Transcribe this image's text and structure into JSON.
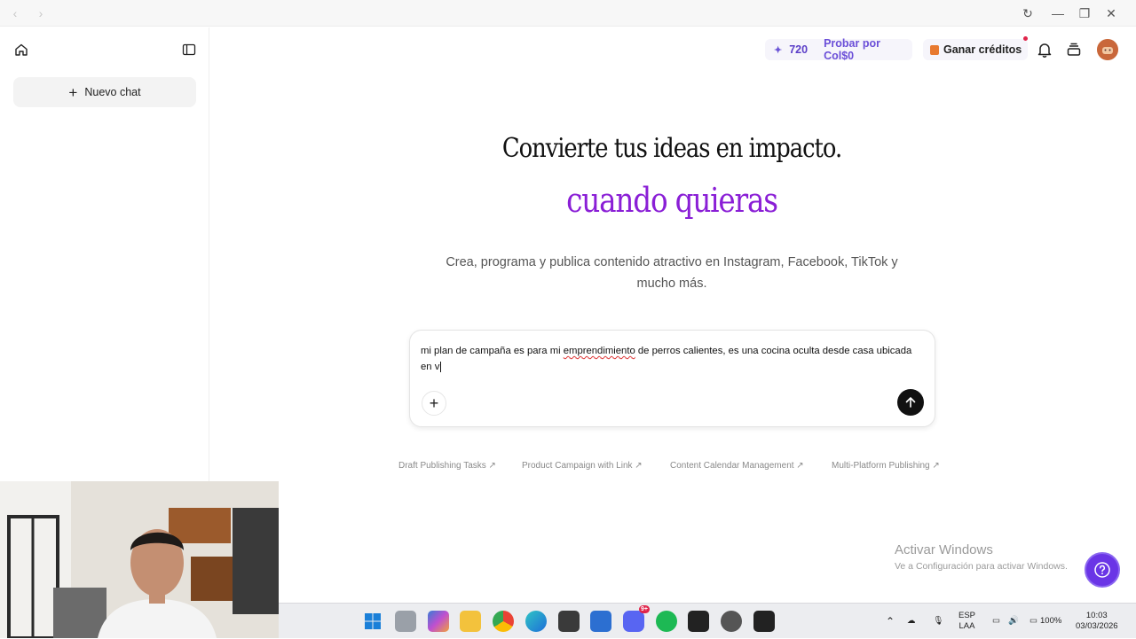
{
  "window": {
    "back_icon": "‹",
    "forward_icon": "›",
    "reload_icon": "↻",
    "minimize_icon": "—",
    "restore_icon": "❐",
    "close_icon": "✕"
  },
  "sidebar": {
    "new_chat_label": "Nuevo chat"
  },
  "header": {
    "credits_count": "720",
    "try_label": "Probar por Col$0",
    "earn_label": "Ganar créditos"
  },
  "hero": {
    "title": "Convierte tus ideas en impacto.",
    "highlight": "cuando quieras",
    "subtitle": "Crea, programa y publica contenido atractivo en Instagram, Facebook, TikTok y mucho más."
  },
  "composer": {
    "text_before": "mi plan de campaña es para mi ",
    "text_misspelled": "emprendimiento",
    "text_after": " de perros calientes, es una cocina oculta desde casa ubicada en v"
  },
  "suggestions": [
    "Draft Publishing Tasks ↗",
    "Product Campaign with Link ↗",
    "Content Calendar Management ↗",
    "Multi-Platform Publishing ↗"
  ],
  "watermark": {
    "title": "Activar Windows",
    "subtitle": "Ve a Configuración para activar Windows."
  },
  "taskbar": {
    "discord_badge": "9+",
    "language": "ESP",
    "keyboard": "LAA",
    "battery": "100%",
    "time": "10:03",
    "date": "03/03/2026"
  },
  "colors": {
    "accent_purple": "#8a1fd6",
    "credits_purple": "#5b3ec8",
    "help_button": "#6a35e6"
  }
}
